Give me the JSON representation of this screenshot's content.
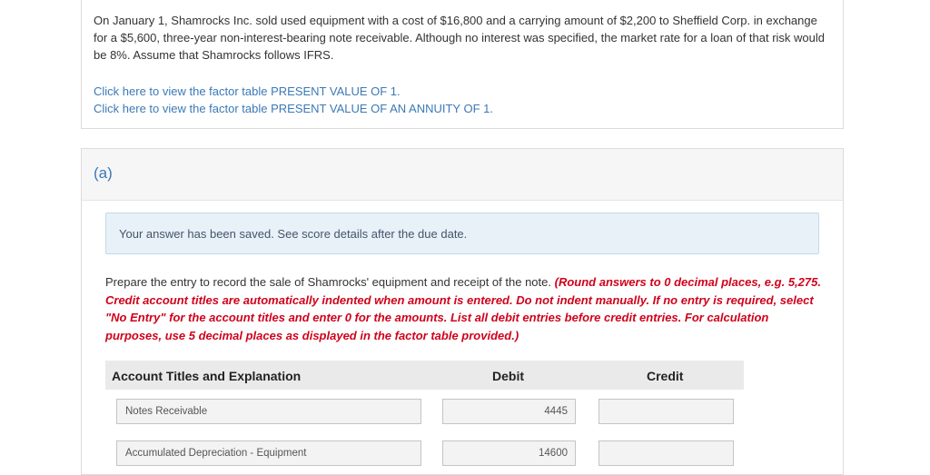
{
  "problem": {
    "text": "On January 1, Shamrocks Inc. sold used equipment with a cost of $16,800 and a carrying amount of $2,200 to Sheffield Corp. in exchange for a $5,600, three-year non-interest-bearing note receivable. Although no interest was specified, the market rate for a loan of that risk would be 8%. Assume that Shamrocks follows IFRS.",
    "link_pv": "Click here to view the factor table PRESENT VALUE OF 1.",
    "link_pva": "Click here to view the factor table PRESENT VALUE OF AN ANNUITY OF 1."
  },
  "part": {
    "label": "(a)"
  },
  "notice": {
    "text": "Your answer has been saved. See score details after the due date."
  },
  "instructions": {
    "text": "Prepare the entry to record the sale of Shamrocks' equipment and receipt of the note.",
    "red": "(Round answers to 0 decimal places, e.g. 5,275. Credit account titles are automatically indented when amount is entered. Do not indent manually. If no entry is required, select \"No Entry\" for the account titles and enter 0 for the amounts. List all debit entries before credit entries. For calculation purposes, use 5 decimal places as displayed in the factor table provided.)"
  },
  "table": {
    "headers": {
      "account": "Account Titles and Explanation",
      "debit": "Debit",
      "credit": "Credit"
    },
    "rows": [
      {
        "account": "Notes Receivable",
        "debit": "4445",
        "credit": ""
      },
      {
        "account": "Accumulated Depreciation - Equipment",
        "debit": "14600",
        "credit": ""
      }
    ]
  },
  "colors": {
    "link": "#3b79b6",
    "warning_red": "#d0021b",
    "notice_bg": "#e8f1f8"
  }
}
